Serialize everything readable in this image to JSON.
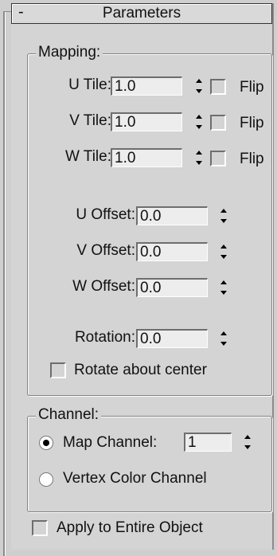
{
  "rollout": {
    "collapse_symbol": "-",
    "title": "Parameters"
  },
  "mapping": {
    "label": "Mapping:",
    "tiles": [
      {
        "label": "U Tile:",
        "value": "1.0",
        "flip_label": "Flip",
        "flip_checked": false
      },
      {
        "label": "V Tile:",
        "value": "1.0",
        "flip_label": "Flip",
        "flip_checked": false
      },
      {
        "label": "W Tile:",
        "value": "1.0",
        "flip_label": "Flip",
        "flip_checked": false
      }
    ],
    "offsets": [
      {
        "label": "U Offset:",
        "value": "0.0"
      },
      {
        "label": "V Offset:",
        "value": "0.0"
      },
      {
        "label": "W Offset:",
        "value": "0.0"
      }
    ],
    "rotation": {
      "label": "Rotation:",
      "value": "0.0"
    },
    "rotate_about_center": {
      "label": "Rotate about center",
      "checked": false
    }
  },
  "channel": {
    "label": "Channel:",
    "map_channel": {
      "label": "Map Channel:",
      "value": "1",
      "selected": true
    },
    "vertex_color_channel": {
      "label": "Vertex Color Channel",
      "selected": false
    }
  },
  "apply_to_entire_object": {
    "label": "Apply to Entire Object",
    "checked": false
  }
}
